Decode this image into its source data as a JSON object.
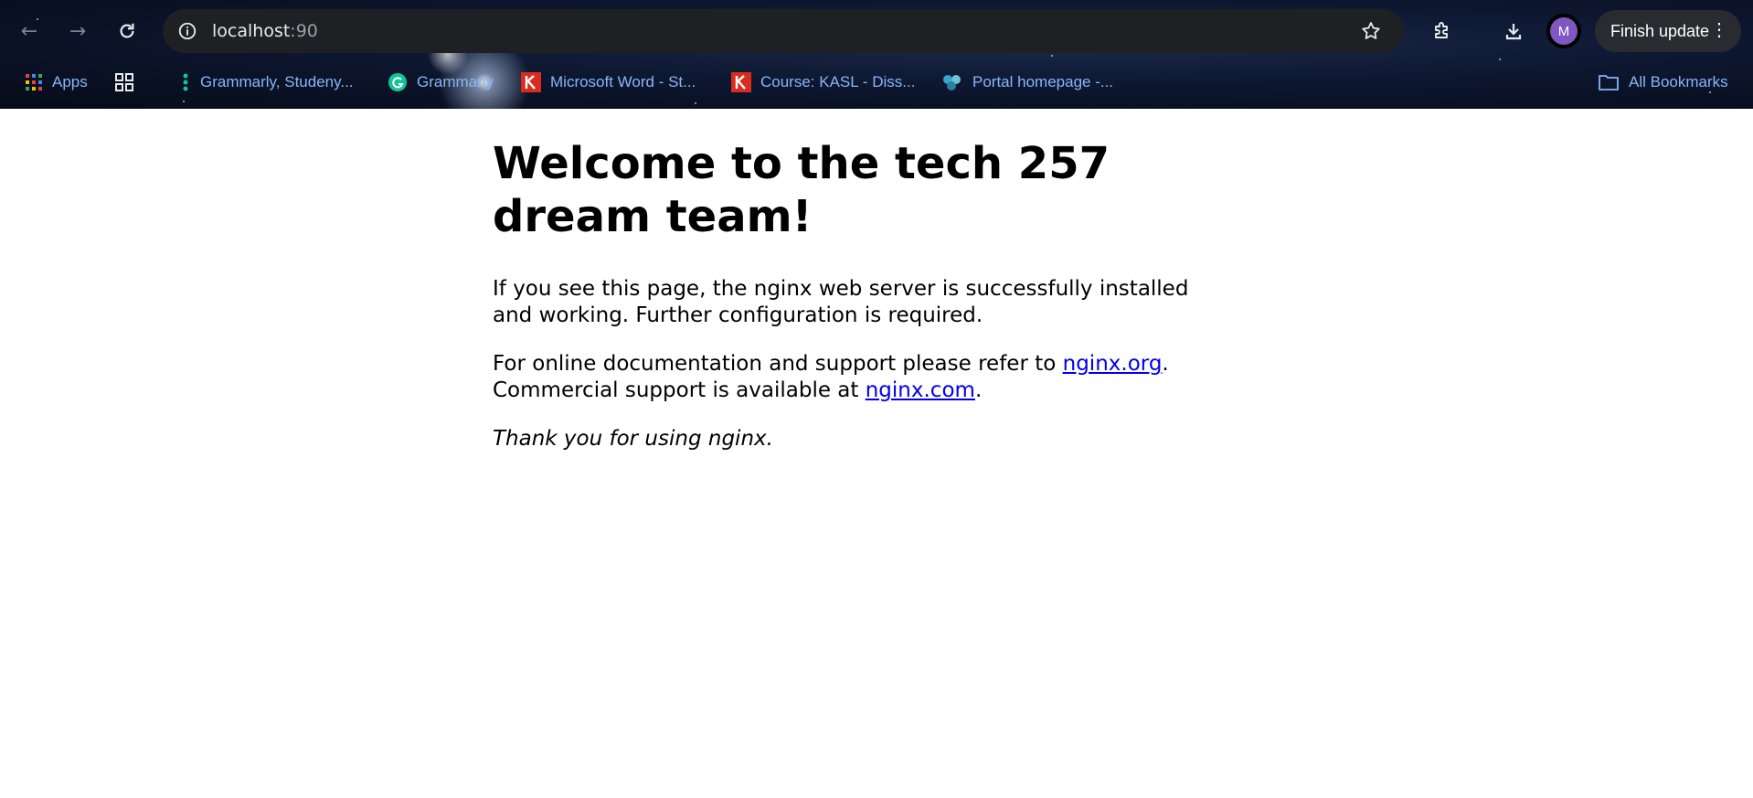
{
  "browser": {
    "url_host": "localhost",
    "url_port": ":90",
    "profile_initial": "M",
    "finish_update_label": "Finish update",
    "bookmarks": [
      {
        "label": "Apps",
        "icon": "apps-grid-icon"
      },
      {
        "label": "",
        "icon": "tab-groups-icon"
      },
      {
        "label": "Grammarly, Studeny...",
        "icon": "grammarly-dots-icon"
      },
      {
        "label": "Grammarly",
        "icon": "grammarly-g-icon"
      },
      {
        "label": "Microsoft Word - St...",
        "icon": "k-logo-icon"
      },
      {
        "label": "Course: KASL - Diss...",
        "icon": "k-logo-icon"
      },
      {
        "label": "Portal homepage -...",
        "icon": "portal-icon"
      }
    ],
    "all_bookmarks_label": "All Bookmarks"
  },
  "page": {
    "heading": "Welcome to the tech 257 dream team!",
    "para1": "If you see this page, the nginx web server is successfully installed and working. Further configuration is required.",
    "para2_prefix": "For online documentation and support please refer to ",
    "link1": "nginx.org",
    "para2_mid": ".",
    "para2_line2": "Commercial support is available at ",
    "link2": "nginx.com",
    "para2_end": ".",
    "thanks": "Thank you for using nginx."
  },
  "colors": {
    "bookmark_text": "#8ab4f8",
    "link": "#0000ee",
    "avatar": "#7e57c2"
  }
}
